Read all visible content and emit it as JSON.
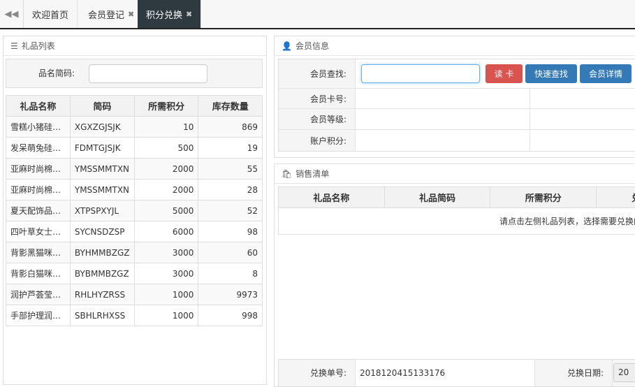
{
  "tabs": [
    {
      "label": "欢迎首页",
      "closable": false,
      "active": false
    },
    {
      "label": "会员登记",
      "closable": true,
      "active": false
    },
    {
      "label": "积分兑换",
      "closable": true,
      "active": true
    }
  ],
  "gift_panel": {
    "title": "礼品列表",
    "search_label": "品名简码:",
    "search_value": "",
    "columns": [
      "礼品名称",
      "简码",
      "所需积分",
      "库存数量"
    ],
    "rows": [
      [
        "雪糕小猪硅…",
        "XGXZGJSJK",
        "10",
        "869"
      ],
      [
        "发呆萌兔硅…",
        "FDMTGJSJK",
        "500",
        "19"
      ],
      [
        "亚麻时尚棉…",
        "YMSSMMTXN",
        "2000",
        "55"
      ],
      [
        "亚麻时尚棉…",
        "YMSSMMTXN",
        "2000",
        "28"
      ],
      [
        "夏天配饰品…",
        "XTPSPXYJL",
        "5000",
        "52"
      ],
      [
        "四叶草女士…",
        "SYCNSDZSP",
        "6000",
        "98"
      ],
      [
        "背影黑猫咪…",
        "BYHMMBZGZ",
        "3000",
        "60"
      ],
      [
        "背影白猫咪…",
        "BYBMMBZGZ",
        "3000",
        "8"
      ],
      [
        "润护芦荟莹…",
        "RHLHYZRSS",
        "1000",
        "9973"
      ],
      [
        "手部护理润…",
        "SBHLRHXSS",
        "1000",
        "998"
      ]
    ]
  },
  "member_panel": {
    "title": "会员信息",
    "search_label": "会员查找:",
    "search_value": "",
    "read_card_label": "读 卡",
    "quick_find_label": "快速查找",
    "detail_label": "会员详情",
    "card_no_label": "会员卡号:",
    "level_label": "会员等级:",
    "points_label": "账户积分:"
  },
  "sales_panel": {
    "title": "销售清单",
    "columns": [
      "礼品名称",
      "礼品简码",
      "所需积分",
      "兑"
    ],
    "hint": "请点击左侧礼品列表，选择需要兑换的"
  },
  "order": {
    "order_no_label": "兑换单号:",
    "order_no_value": "2018120415133176",
    "date_label": "兑换日期:",
    "date_value": "20"
  },
  "colors": {
    "tab_active": "#2f3a40",
    "btn_red": "#d9534f",
    "btn_blue": "#337ab7"
  }
}
